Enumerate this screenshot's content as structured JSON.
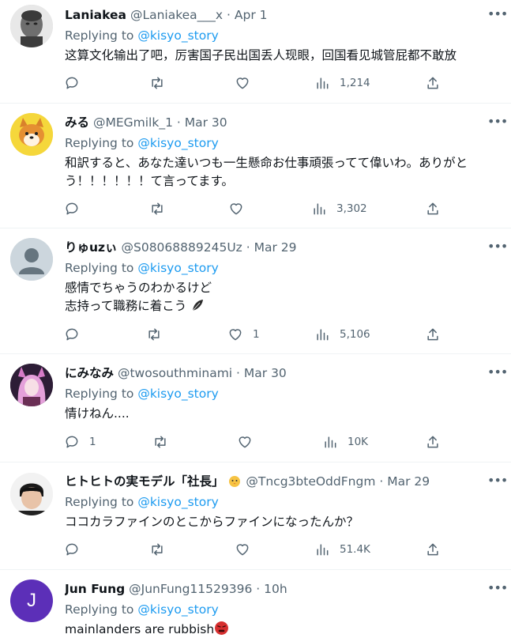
{
  "replying_to_label": "Replying to",
  "tweets": [
    {
      "name": "Laniakea",
      "handle": "@Laniakea___x",
      "date": "· Apr 1",
      "replying_to": "@kisyo_story",
      "lines": [
        "这算文化输出了吧，厉害国子民出国丢人现眼，回国看见城管屁都不敢放"
      ],
      "replies": "",
      "retweets": "",
      "likes": "",
      "views": "1,214"
    },
    {
      "name": "みる",
      "handle": "@MEGmilk_1",
      "date": "· Mar 30",
      "replying_to": "@kisyo_story",
      "lines": [
        "和訳すると、あなた達いつも一生懸命お仕事頑張ってて偉いわ。ありがと",
        "う！！！！！！て言ってます。"
      ],
      "replies": "",
      "retweets": "",
      "likes": "",
      "views": "3,302"
    },
    {
      "name": "りゅuzぃ",
      "handle": "@S08068889245Uz",
      "date": "· Mar 29",
      "replying_to": "@kisyo_story",
      "lines": [
        "感情でちゃうのわかるけど",
        "志持って職務に着こう"
      ],
      "replies": "",
      "retweets": "",
      "likes": "1",
      "views": "5,106"
    },
    {
      "name": "にみなみ",
      "handle": "@twosouthminami",
      "date": "· Mar 30",
      "replying_to": "@kisyo_story",
      "lines": [
        "情けねん...."
      ],
      "replies": "1",
      "retweets": "",
      "likes": "",
      "views": "10K"
    },
    {
      "name": "ヒトヒトの実モデル「社長」",
      "handle": "@Tncg3bteOddFngm",
      "date": "· Mar 29",
      "replying_to": "@kisyo_story",
      "lines": [
        "ココカラファインのとこからファインになったんか？"
      ],
      "replies": "",
      "retweets": "",
      "likes": "",
      "views": "51.4K"
    },
    {
      "name": "Jun Fung",
      "handle": "@JunFung11529396",
      "date": "· 10h",
      "replying_to": "@kisyo_story",
      "lines": [
        "mainlanders are rubbish"
      ],
      "replies": "",
      "retweets": "",
      "likes": "",
      "views": ""
    }
  ],
  "avatar_initial_jun": "J",
  "colors": {
    "link": "#1d9bf0",
    "muted": "#536471",
    "text": "#0f1419",
    "divider": "#eff3f4",
    "jun_avatar": "#5c2fb8"
  }
}
